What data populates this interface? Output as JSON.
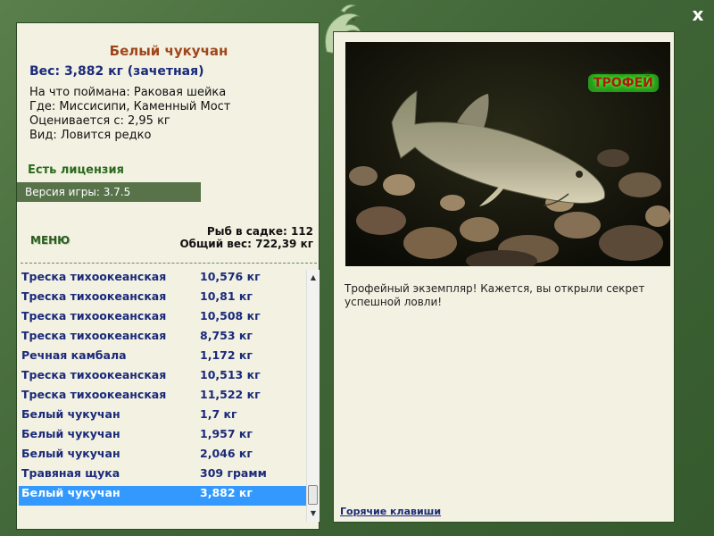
{
  "header": {
    "close_label": "x"
  },
  "catch": {
    "title": "Белый чукучан",
    "weight": "Вес: 3,882 кг (зачетная)",
    "bait": "На что поймана: Раковая шейка",
    "location": "Где: Миссисипи, Каменный Мост",
    "value": "Оценивается с: 2,95 кг",
    "rarity": "Вид: Ловится редко",
    "license": "Есть лицензия",
    "version": "Версия игры: 3.7.5"
  },
  "menu_label": "МЕНЮ",
  "stats": {
    "fish_in_keepnet": "Рыб в садке: 112",
    "total_weight": "Общий вес: 722,39 кг"
  },
  "fish_list": [
    {
      "name": "Треска тихоокеанская",
      "weight": "10,576 кг"
    },
    {
      "name": "Треска тихоокеанская",
      "weight": "10,81 кг"
    },
    {
      "name": "Треска тихоокеанская",
      "weight": "10,508 кг"
    },
    {
      "name": "Треска тихоокеанская",
      "weight": "8,753 кг"
    },
    {
      "name": "Речная камбала",
      "weight": "1,172 кг"
    },
    {
      "name": "Треска тихоокеанская",
      "weight": "10,513 кг"
    },
    {
      "name": "Треска тихоокеанская",
      "weight": "11,522 кг"
    },
    {
      "name": "Белый чукучан",
      "weight": "1,7 кг"
    },
    {
      "name": "Белый чукучан",
      "weight": "1,957 кг"
    },
    {
      "name": "Белый чукучан",
      "weight": "2,046 кг"
    },
    {
      "name": "Травяная щука",
      "weight": "309 грамм"
    },
    {
      "name": "Белый чукучан",
      "weight": "3,882 кг"
    }
  ],
  "selected_index": 11,
  "photo": {
    "badge": "ТРОФЕЙ"
  },
  "description": "Трофейный экземпляр! Кажется, вы открыли секрет успешной ловли!",
  "hotkeys_label": "Горячие клавиши",
  "colors": {
    "frame": "#3f6436",
    "panel": "#f3f1e2",
    "title": "#a0461c",
    "list_text": "#1a2a7a",
    "selection": "#3399ff",
    "version_bar": "#58734a"
  }
}
